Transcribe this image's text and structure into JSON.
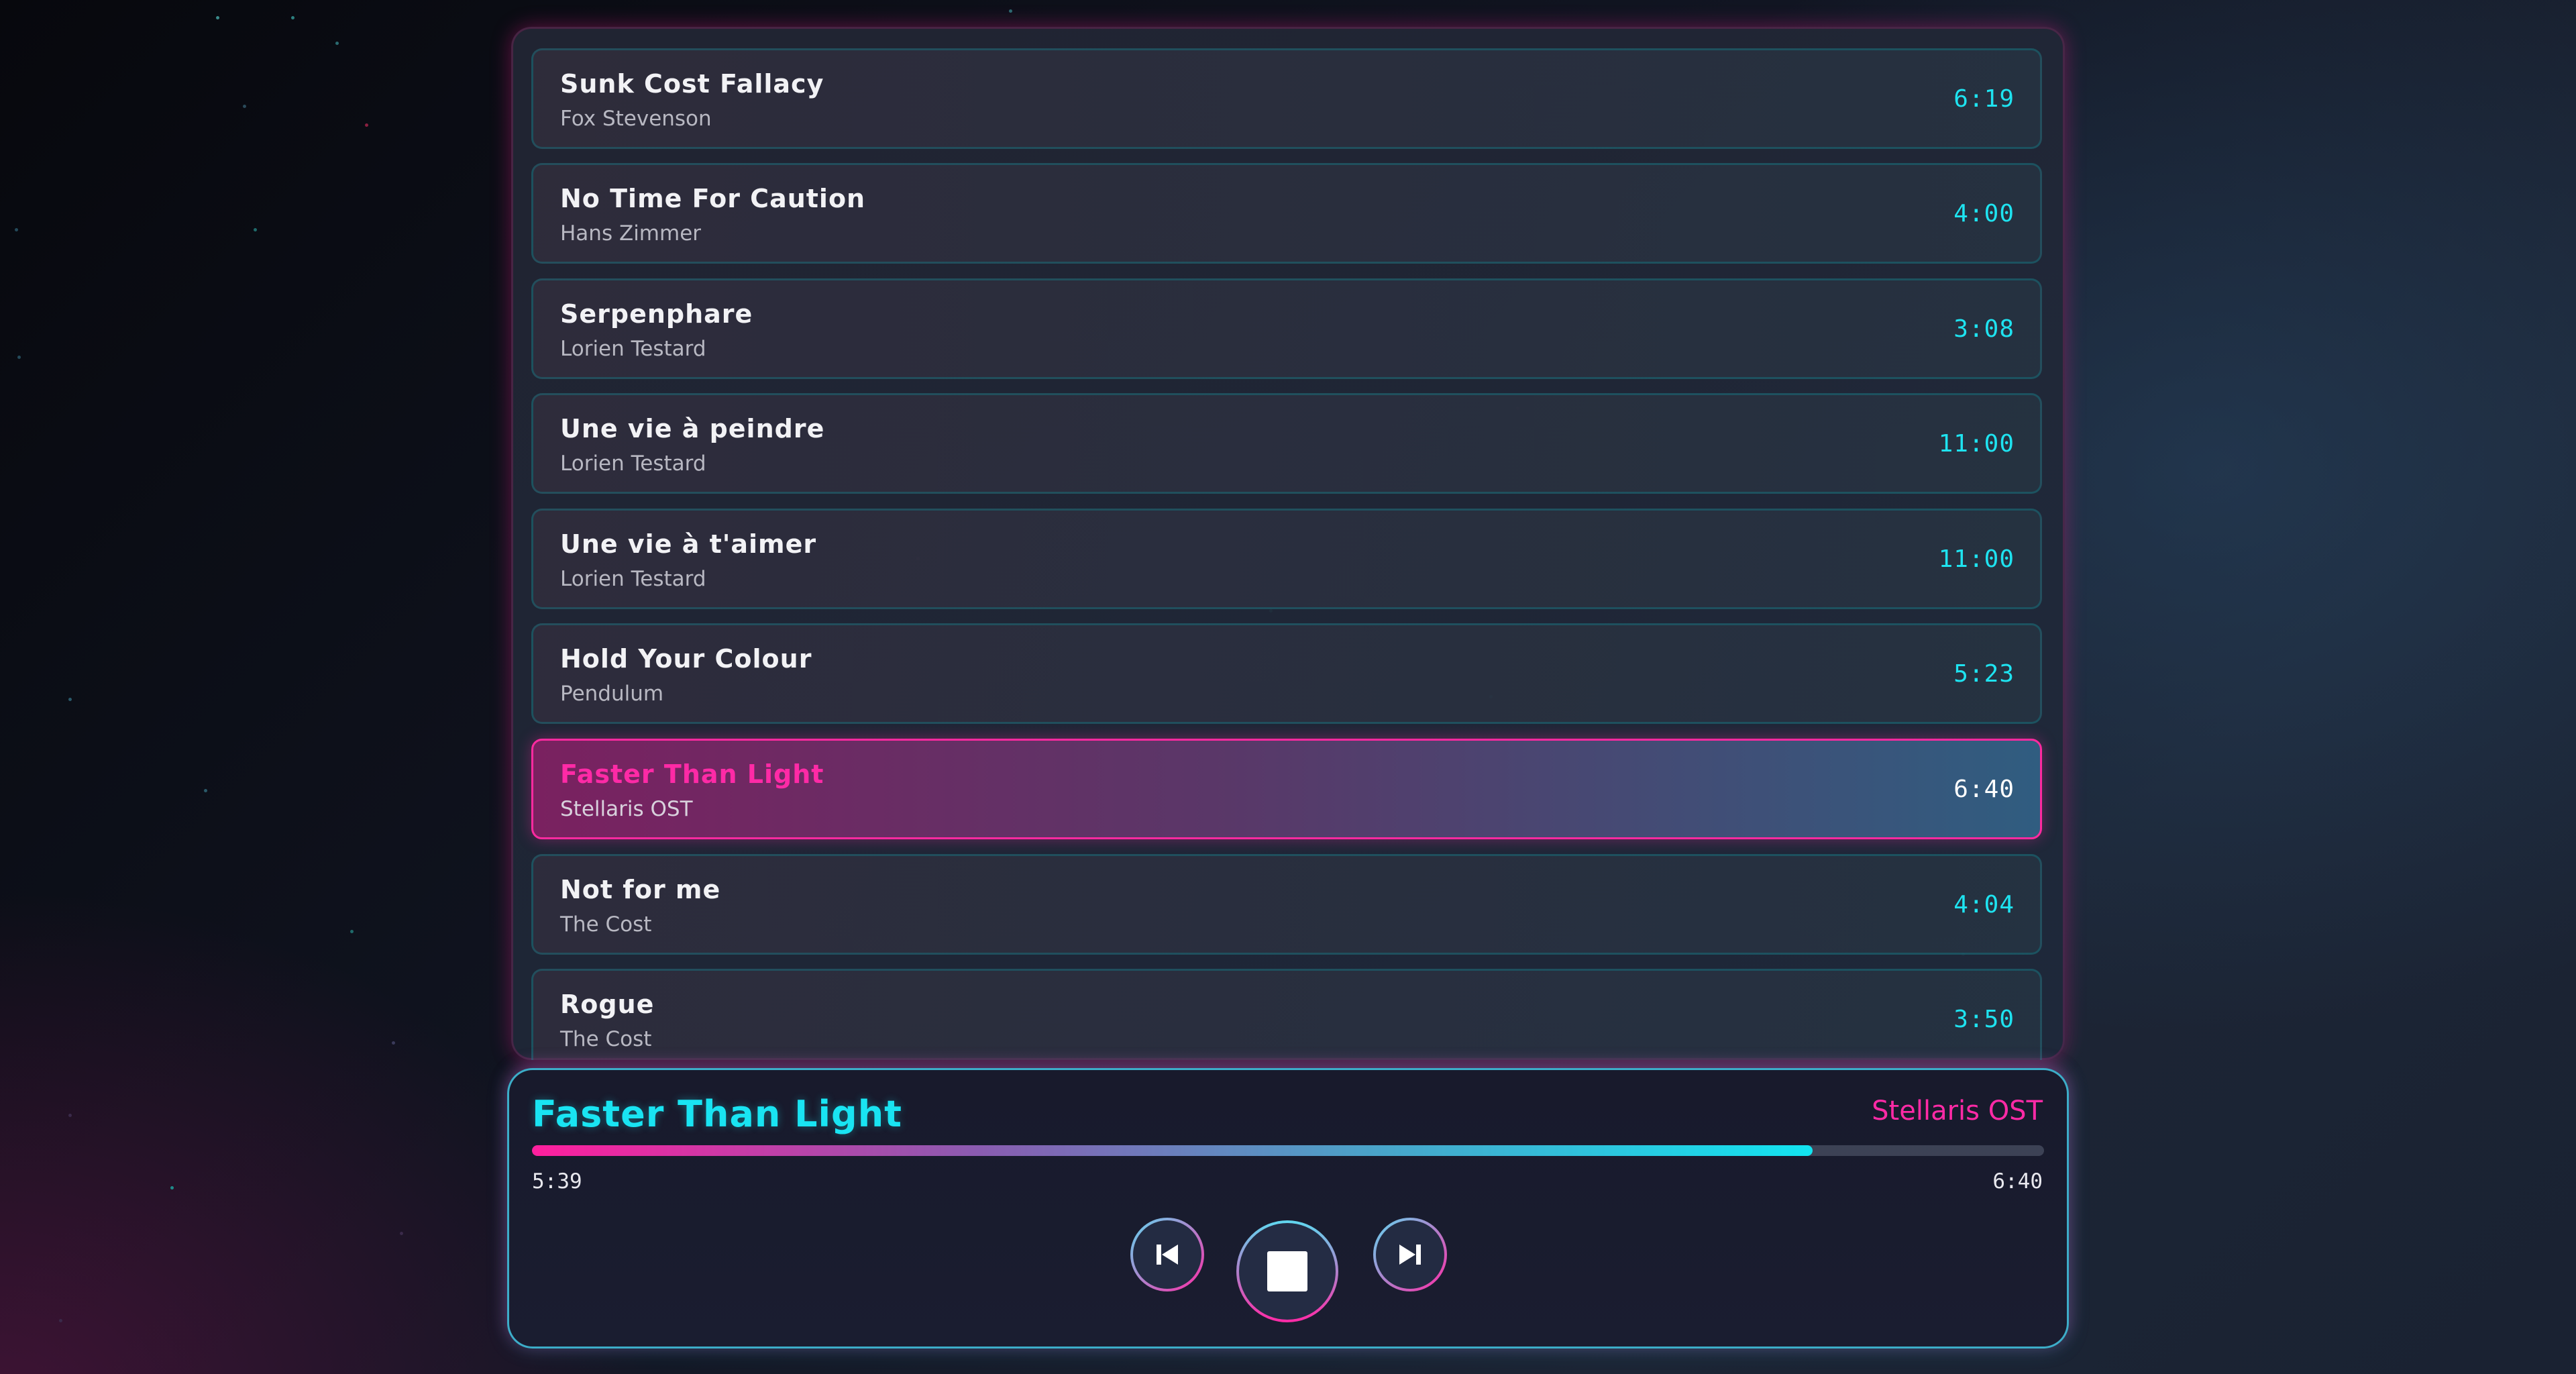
{
  "playlist": {
    "tracks": [
      {
        "title": "Sunk Cost Fallacy",
        "artist": "Fox Stevenson",
        "duration": "6:19"
      },
      {
        "title": "No Time For Caution",
        "artist": "Hans Zimmer",
        "duration": "4:00"
      },
      {
        "title": "Serpenphare",
        "artist": "Lorien Testard",
        "duration": "3:08"
      },
      {
        "title": "Une vie à peindre",
        "artist": "Lorien Testard",
        "duration": "11:00"
      },
      {
        "title": "Une vie à t'aimer",
        "artist": "Lorien Testard",
        "duration": "11:00"
      },
      {
        "title": "Hold Your Colour",
        "artist": "Pendulum",
        "duration": "5:23"
      },
      {
        "title": "Faster Than Light",
        "artist": "Stellaris OST",
        "duration": "6:40",
        "active": true
      },
      {
        "title": "Not for me",
        "artist": "The Cost",
        "duration": "4:04"
      },
      {
        "title": "Rogue",
        "artist": "The Cost",
        "duration": "3:50"
      }
    ]
  },
  "player": {
    "title": "Faster Than Light",
    "artist": "Stellaris OST",
    "current_time": "5:39",
    "total_time": "6:40",
    "progress_fraction": 0.847,
    "controls": {
      "previous_icon": "skip-previous-icon",
      "stop_icon": "stop-icon",
      "next_icon": "skip-next-icon"
    }
  },
  "colors": {
    "accent_cyan": "#19e4f2",
    "accent_pink": "#ff2aa6"
  }
}
